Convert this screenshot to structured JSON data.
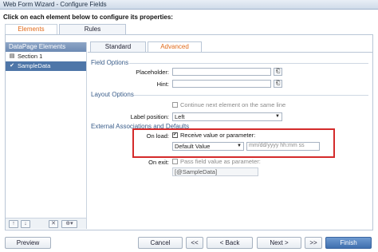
{
  "window": {
    "title": "Web Form Wizard - Configure Fields"
  },
  "instruction": "Click on each element below to configure its properties:",
  "top_tabs": [
    {
      "label": "Elements",
      "active": true
    },
    {
      "label": "Rules",
      "active": false
    }
  ],
  "left_panel": {
    "header": "DataPage Elements",
    "items": [
      {
        "label": "Section 1",
        "icon": "section-icon",
        "selected": false
      },
      {
        "label": "SampleData",
        "icon": "check-icon",
        "selected": true
      }
    ],
    "toolbar": {
      "up": "↑",
      "down": "↓",
      "delete": "✕",
      "add": "⊕▾"
    }
  },
  "inner_tabs": [
    {
      "label": "Standard",
      "active": false
    },
    {
      "label": "Advanced",
      "active": true
    }
  ],
  "field_options": {
    "title": "Field Options",
    "placeholder_label": "Placeholder:",
    "placeholder_value": "",
    "hint_label": "Hint:",
    "hint_value": ""
  },
  "layout_options": {
    "title": "Layout Options",
    "continue_label": "Continue next element on the same line",
    "continue_checked": false,
    "label_position_label": "Label position:",
    "label_position_value": "Left"
  },
  "external": {
    "title": "External Associations and Defaults",
    "on_load_label": "On load:",
    "receive_label": "Receive value or parameter:",
    "receive_checked": true,
    "default_value_select": "Default Value",
    "date_placeholder": "mm/dd/yyyy hh:mm ss",
    "on_exit_label": "On exit:",
    "pass_label": "Pass field value as parameter:",
    "pass_checked": false,
    "pass_value": "[@SampleData]"
  },
  "footer": {
    "preview": "Preview",
    "cancel": "Cancel",
    "first": "<<",
    "back": "< Back",
    "next": "Next >",
    "last": ">>",
    "finish": "Finish"
  },
  "colors": {
    "accent": "#e06a1a",
    "highlight_box": "#d42b2b",
    "selected_item": "#4e76a8"
  }
}
